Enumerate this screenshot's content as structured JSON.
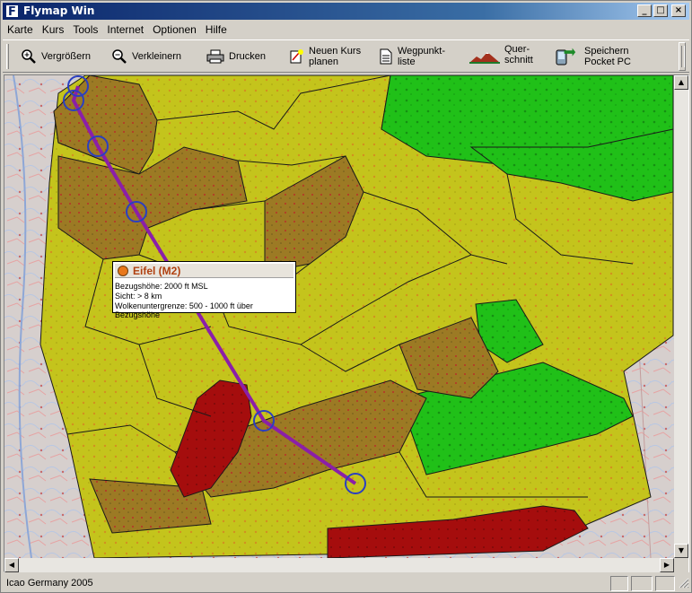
{
  "window": {
    "title": "Flymap Win",
    "icon_letter": "F"
  },
  "menu": [
    "Karte",
    "Kurs",
    "Tools",
    "Internet",
    "Optionen",
    "Hilfe"
  ],
  "toolbar": {
    "zoom_in": "Vergrößern",
    "zoom_out": "Verkleinern",
    "print": "Drucken",
    "new_course_1": "Neuen Kurs",
    "new_course_2": "planen",
    "waypoint_1": "Wegpunkt-",
    "waypoint_2": "liste",
    "profile_1": "Quer-",
    "profile_2": "schnitt",
    "pocket_1": "Speichern",
    "pocket_2": "Pocket PC"
  },
  "tooltip": {
    "title": "Eifel (M2)",
    "line1": "Bezugshöhe: 2000 ft MSL",
    "line2": "Sicht: > 8 km",
    "line3": "Wolkenuntergrenze: 500 - 1000 ft über Bezugshöhe"
  },
  "status": {
    "text": "Icao Germany 2005"
  },
  "colors": {
    "title_start": "#0a246a",
    "route": "#8b1fa8",
    "waypoint": "#2b3fc0",
    "zone_green": "#22c41a",
    "zone_yellow": "#c8c81e",
    "zone_brown": "#9c7a24",
    "zone_red": "#a50d0d"
  }
}
